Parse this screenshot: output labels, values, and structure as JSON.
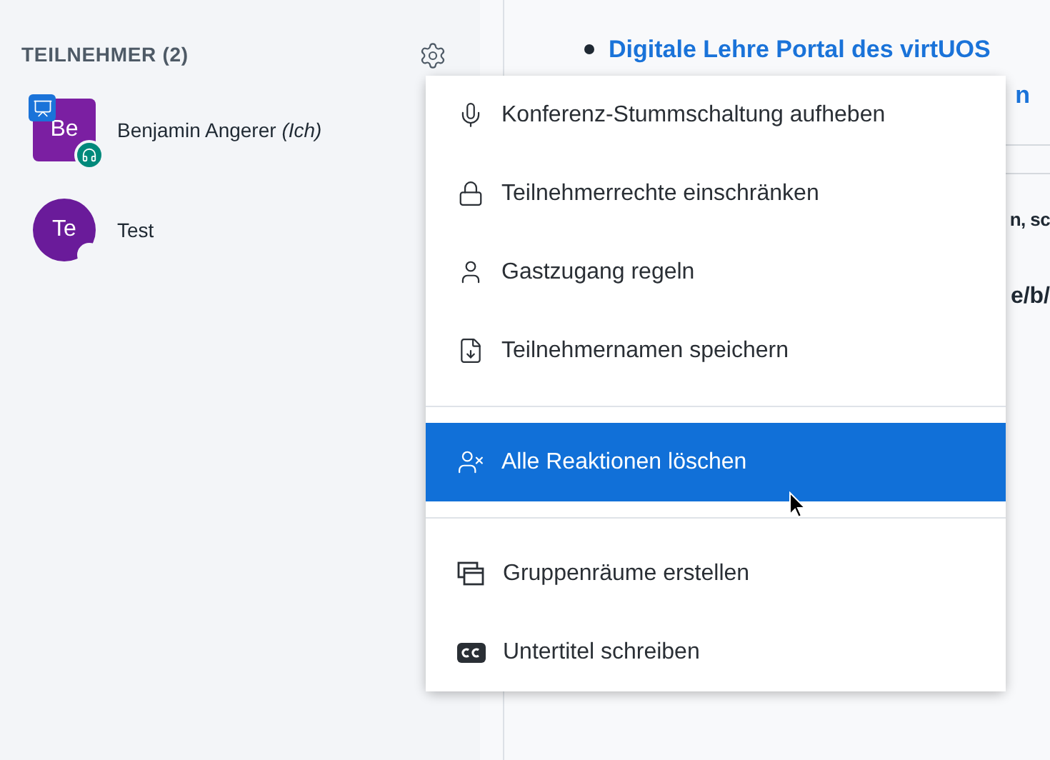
{
  "sidebar": {
    "title": "TEILNEHMER (2)",
    "participants": [
      {
        "initials": "Be",
        "name": "Benjamin Angerer *(Ich)*",
        "color": "#7b1fa2",
        "presenter": true
      },
      {
        "initials": "Te",
        "name": "Test",
        "color": "#6a1b9a",
        "presenter": false
      }
    ]
  },
  "content": {
    "link": "Digitale Lehre Portal des virtUOS",
    "fragments": [
      "n",
      "n, sc",
      "e/b/"
    ]
  },
  "menu": [
    {
      "kind": "item",
      "label": "Konferenz-Stummschaltung aufheben",
      "selected": false
    },
    {
      "kind": "item",
      "label": "Teilnehmerrechte einschränken",
      "selected": false
    },
    {
      "kind": "item",
      "label": "Gastzugang regeln",
      "selected": false
    },
    {
      "kind": "item",
      "label": "Teilnehmernamen speichern",
      "selected": false
    },
    {
      "kind": "divider"
    },
    {
      "kind": "item",
      "label": "Alle Reaktionen löschen",
      "selected": true
    },
    {
      "kind": "divider"
    },
    {
      "kind": "item",
      "label": "Gruppenräume erstellen",
      "selected": false
    },
    {
      "kind": "item",
      "label": "Untertitel schreiben",
      "selected": false
    }
  ]
}
